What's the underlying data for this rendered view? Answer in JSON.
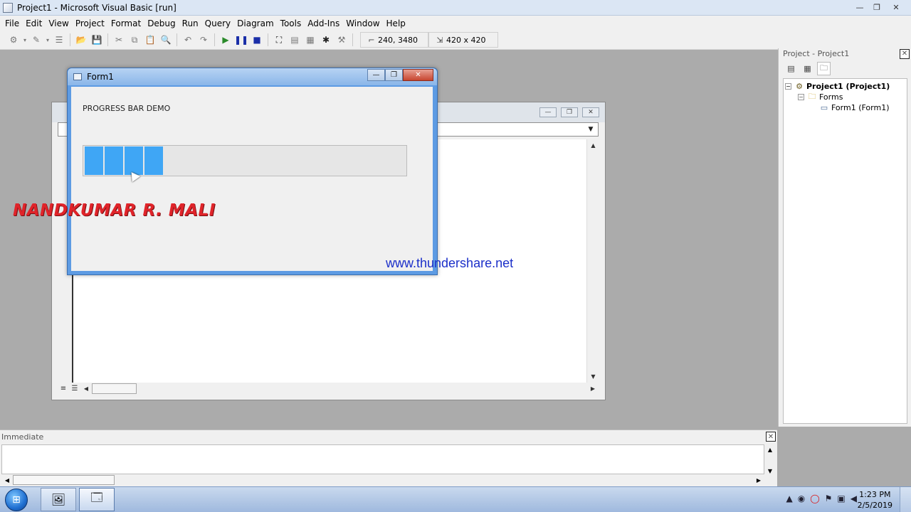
{
  "window": {
    "title": "Project1 - Microsoft Visual Basic [run]",
    "minimize": "—",
    "restore": "❐",
    "close": "✕"
  },
  "menu": [
    "File",
    "Edit",
    "View",
    "Project",
    "Format",
    "Debug",
    "Run",
    "Query",
    "Diagram",
    "Tools",
    "Add-Ins",
    "Window",
    "Help"
  ],
  "toolbar": {
    "position_readout": "240, 3480",
    "size_readout": "420 x 420"
  },
  "form1": {
    "title": "Form1",
    "caption": "PROGRESS BAR DEMO",
    "progress_percent": 25,
    "chunks_filled": 4
  },
  "designer": {
    "minimize": "—",
    "restore": "❐",
    "close": "✕"
  },
  "project_explorer": {
    "title": "Project - Project1",
    "tree": [
      {
        "label": "Project1 (Project1)",
        "level": 0
      },
      {
        "label": "Forms",
        "level": 1
      },
      {
        "label": "Form1 (Form1)",
        "level": 2
      }
    ]
  },
  "immediate": {
    "title": "Immediate"
  },
  "watermark": {
    "name": "NANDKUMAR R. MALI",
    "url": "www.thundershare.net"
  },
  "taskbar": {
    "time": "1:23 PM",
    "date": "2/5/2019"
  },
  "colors": {
    "progress_fill": "#3fa6f5",
    "name_red": "#e0242a",
    "url_blue": "#1b2fc9"
  }
}
